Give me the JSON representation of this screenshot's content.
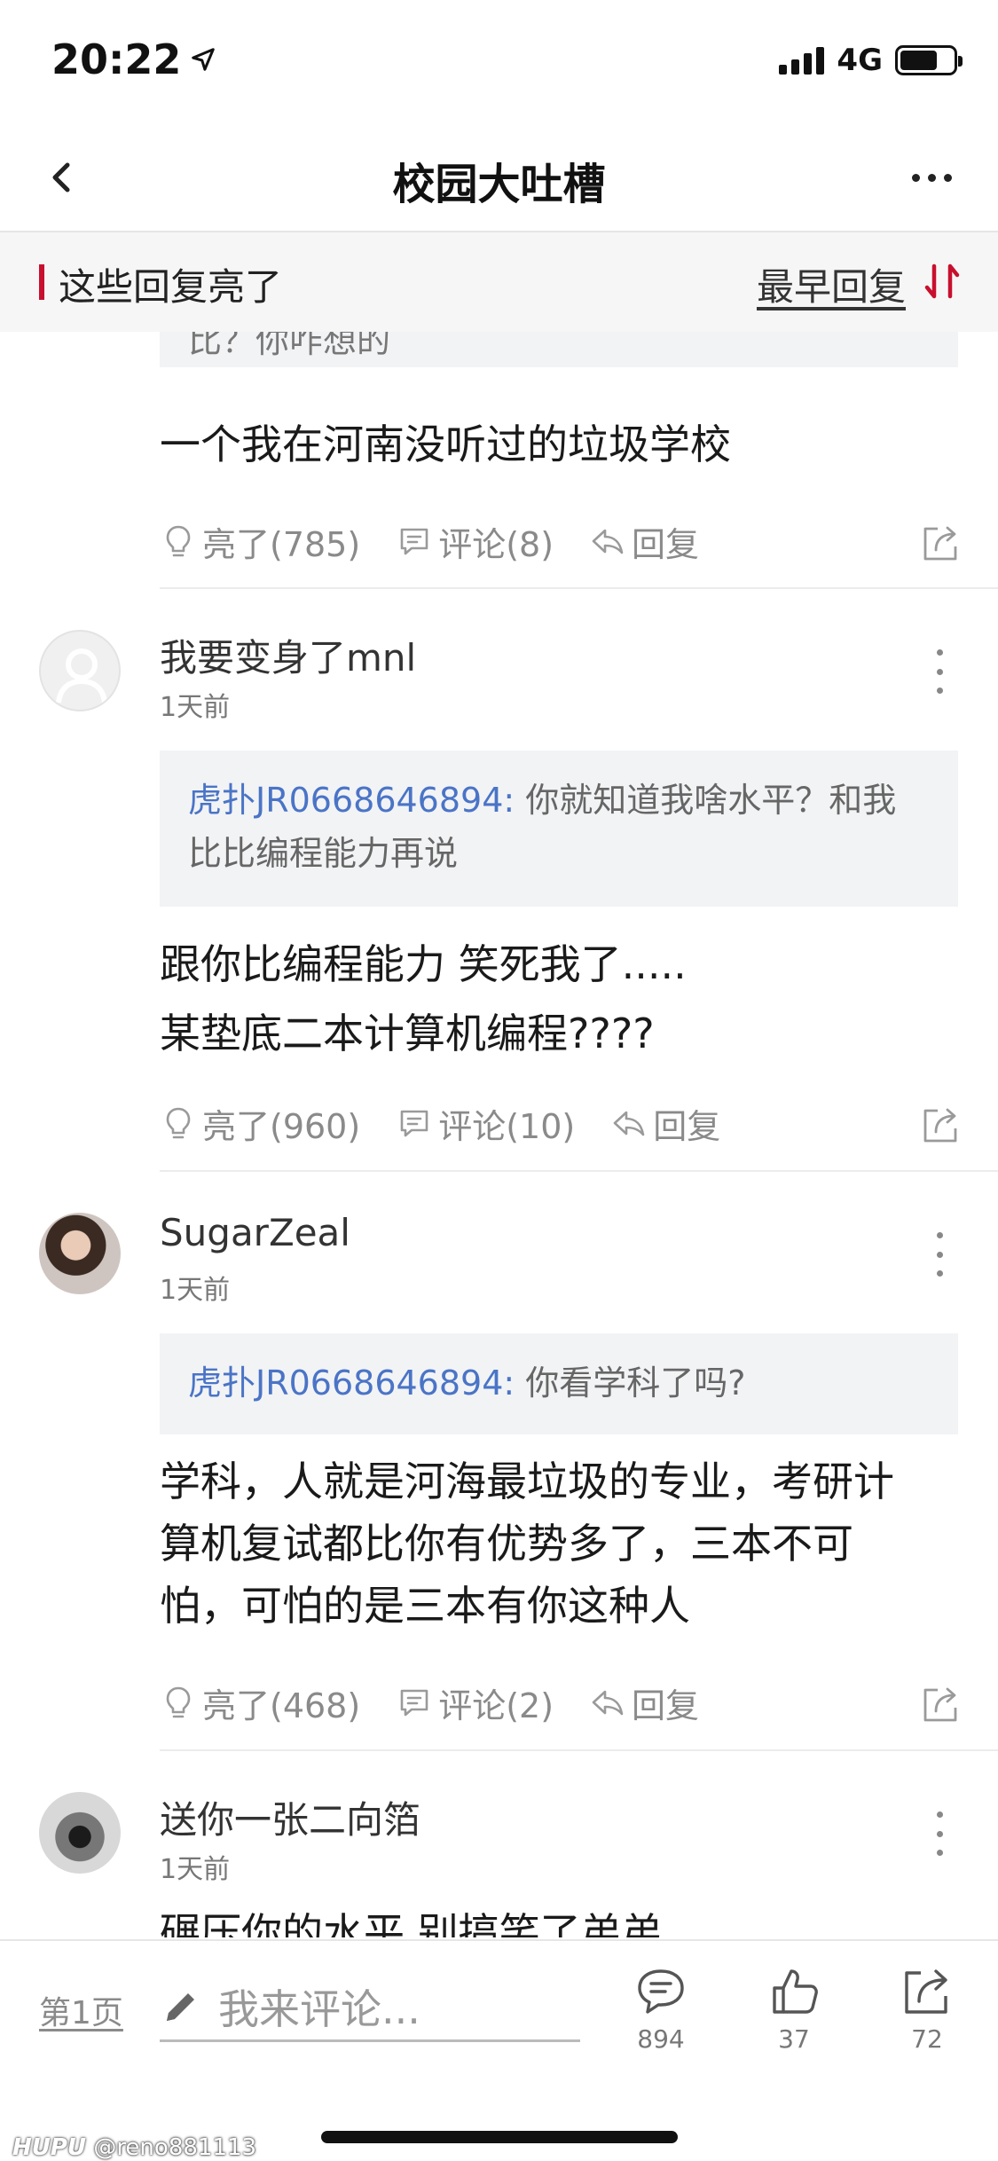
{
  "status_bar": {
    "time": "20:22",
    "network": "4G",
    "battery_level": 0.7
  },
  "nav": {
    "title": "校园大吐槽"
  },
  "sort_bar": {
    "title": "这些回复亮了",
    "order_label": "最早回复"
  },
  "partial_post": {
    "quote_fragment": "比？你咋想的",
    "text": "一个我在河南没听过的垃圾学校",
    "like_label": "亮了(785)",
    "comment_label": "评论(8)",
    "reply_label": "回复"
  },
  "posts": [
    {
      "username": "我要变身了mnl",
      "time": "1天前",
      "quote_name": "虎扑JR0668646894:",
      "quote_text": " 你就知道我啥水平？和我比比编程能力再说",
      "text_lines": [
        "跟你比编程能力   笑死我了.....",
        "某垫底二本计算机编程????"
      ],
      "like_label": "亮了(960)",
      "comment_label": "评论(10)",
      "reply_label": "回复"
    },
    {
      "username": "SugarZeal",
      "time": "1天前",
      "quote_name": "虎扑JR0668646894:",
      "quote_text": " 你看学科了吗?",
      "text_lines": [
        "学科，人就是河海最垃圾的专业，考研计",
        "算机复试都比你有优势多了，三本不可",
        "怕，可怕的是三本有你这种人"
      ],
      "like_label": "亮了(468)",
      "comment_label": "评论(2)",
      "reply_label": "回复"
    },
    {
      "username": "送你一张二向箔",
      "time": "1天前",
      "text_lines": [
        "碾压你的水平 别搞笑了弟弟"
      ]
    }
  ],
  "bottom_bar": {
    "page_label": "第1页",
    "comment_placeholder": "我来评论...",
    "comment_count": "894",
    "like_count": "37",
    "share_count": "72"
  },
  "watermark": {
    "brand": "HUPU",
    "user": "@reno881113"
  },
  "colors": {
    "accent_red": "#c8102e",
    "link_blue": "#4a74c6",
    "quote_bg": "#f2f3f5"
  },
  "icons": [
    "location-arrow-icon",
    "signal-icon",
    "battery-icon",
    "back-icon",
    "more-icon",
    "sort-icon",
    "bulb-icon",
    "comment-icon",
    "reply-icon",
    "share-icon",
    "pen-icon",
    "thumbs-up-icon"
  ]
}
